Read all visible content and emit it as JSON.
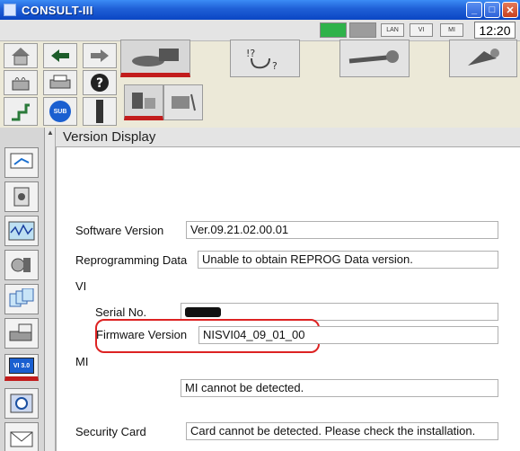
{
  "window": {
    "title": "CONSULT-III"
  },
  "statusbar": {
    "indicators": [
      "LAN",
      "VI",
      "MI"
    ],
    "time": "12:20"
  },
  "toolbar": {
    "icons": [
      "home-icon",
      "back-arrow-icon",
      "forward-arrow-icon",
      "printer-icon",
      "help-icon",
      "sub-icon"
    ],
    "tabs": [
      "vehicle-connect-icon",
      "diagnosis-stethoscope-icon",
      "wrench-icon",
      "repair-icon"
    ],
    "sub_label": "SUB"
  },
  "sidebar": {
    "vi_badge": "VI 3.0"
  },
  "main": {
    "title": "Version Display",
    "software_version": {
      "label": "Software Version",
      "value": "Ver.09.21.02.00.01"
    },
    "reprogramming_data": {
      "label": "Reprogramming Data",
      "value": "Unable to obtain REPROG Data version."
    },
    "vi_section": "VI",
    "serial_no": {
      "label": "Serial No.",
      "value": ""
    },
    "firmware_version": {
      "label": "Firmware Version",
      "value": "NISVI04_09_01_00"
    },
    "mi_section": "MI",
    "mi_status": "MI cannot be detected.",
    "security_card": {
      "label": "Security Card",
      "value": "Card cannot be detected. Please check the installation."
    }
  },
  "colors": {
    "accent_red": "#c21c1c",
    "titlebar_blue": "#1f5fd6",
    "status_green": "#2fb24a"
  }
}
